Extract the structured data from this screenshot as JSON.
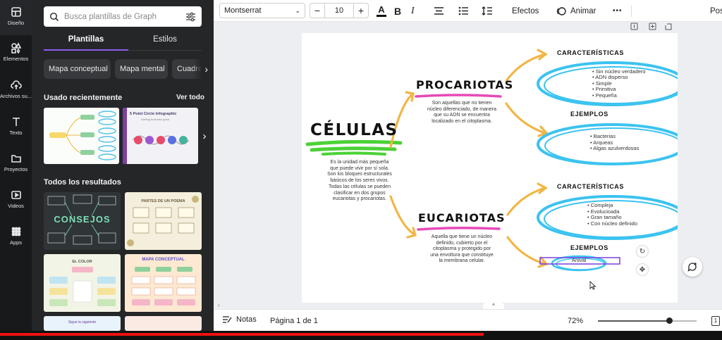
{
  "rail": {
    "items": [
      {
        "label": "Diseño",
        "icon": "layout-icon"
      },
      {
        "label": "Elementos",
        "icon": "shapes-icon"
      },
      {
        "label": "Archivos su...",
        "icon": "cloud-upload-icon"
      },
      {
        "label": "Texto",
        "icon": "text-icon"
      },
      {
        "label": "Proyectos",
        "icon": "folder-icon"
      },
      {
        "label": "Videos",
        "icon": "video-icon"
      },
      {
        "label": "Apps",
        "icon": "apps-icon"
      }
    ]
  },
  "panel": {
    "search_placeholder": "Busca plantillas de Graph",
    "tabs": [
      "Plantillas",
      "Estilos"
    ],
    "chips": [
      "Mapa conceptual",
      "Mapa mental",
      "Cuadro"
    ],
    "recent_title": "Usado recientemente",
    "see_all": "Ver todo",
    "recent_thumb_title": "5 Point Circle Infographic",
    "recent_thumb_subtitle": "Getting business goals",
    "results_title": "Todos los resultados",
    "thumb_consejos": "CONSEJOS",
    "thumb_partes": "PARTES DE UN POEMA",
    "thumb_color": "EL COLOR",
    "thumb_mapa": "MAPA CONCEPTUAL",
    "thumb_sigue": "Sigue la siguiente"
  },
  "toolbar": {
    "font": "Montserrat",
    "size": "10",
    "effects": "Efectos",
    "animate": "Animar",
    "more": "•••",
    "position": "Pos"
  },
  "map": {
    "title": "CÉLULAS",
    "intro": [
      "Es la unidad más pequeña",
      "que puede vivir por sí sola.",
      "Son los bloques estructurales",
      "básicos de los seres vivos.",
      "Todas las células se pueden",
      "clasificar en dos grupos",
      "eucariotas y procariotas."
    ],
    "pro_title": "PROCARIOTAS",
    "pro_desc": [
      "Son aquellas que no tienen",
      "núcleo diferenciado, de manera",
      "que su ADN se encuentra",
      "localizado en el citoplasma."
    ],
    "pro_char_title": "CARACTERÍSTICAS",
    "pro_chars": [
      "Sin núcleo verdadero",
      "ADN disperso",
      "Simple",
      "Primitiva",
      "Pequeña"
    ],
    "pro_ex_title": "EJEMPLOS",
    "pro_examples": [
      "Bacterias",
      "Arqueas",
      "Algas azulverdosas"
    ],
    "euk_title": "EUCARIOTAS",
    "euk_desc": [
      "Aquella que tiene un núcleo",
      "definido, cubierto por el",
      "citoplasma y protegido por",
      "una envoltura que constituye",
      "la membrana celular."
    ],
    "euk_char_title": "CARACTERÍSTICAS",
    "euk_chars": [
      "Compleja",
      "Evolucioada",
      "Gran tamaño",
      "Con núcleo definido"
    ],
    "euk_ex_title": "EJEMPLOS",
    "euk_example_editing": "Anival"
  },
  "bottom": {
    "notes": "Notas",
    "page": "Página 1 de 1",
    "zoom": "72%",
    "zoom_level": 0.72,
    "pages_count": "1"
  },
  "video_progress": 0.67,
  "colors": {
    "accent_purple": "#8b5cf6",
    "arrow_orange": "#f2b544",
    "oval_blue": "#3cc3f0",
    "highlight_green": "#4cd137",
    "highlight_pink": "#e64ab8",
    "progress_red": "#ee1111"
  }
}
